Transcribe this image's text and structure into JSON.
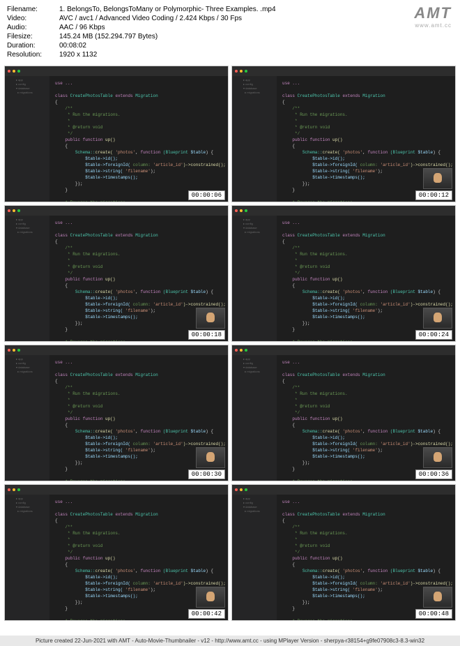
{
  "header": {
    "filename_label": "Filename:",
    "filename": "1. BelongsTo, BelongsToMany or Polymorphic-  Three Examples. .mp4",
    "video_label": "Video:",
    "video": "AVC / avc1 / Advanced Video Coding / 2.424 Kbps / 30 Fps",
    "audio_label": "Audio:",
    "audio": "AAC / 96 Kbps",
    "filesize_label": "Filesize:",
    "filesize": "145.24 MB (152.294.797 Bytes)",
    "duration_label": "Duration:",
    "duration": "00:08:02",
    "resolution_label": "Resolution:",
    "resolution": "1920 x 1132"
  },
  "logo": {
    "main": "AMT",
    "sub": "www.amt.cc"
  },
  "thumbnails": [
    {
      "timestamp": "00:00:06",
      "has_webcam": false
    },
    {
      "timestamp": "00:00:12",
      "has_webcam": true
    },
    {
      "timestamp": "00:00:18",
      "has_webcam": true
    },
    {
      "timestamp": "00:00:24",
      "has_webcam": true
    },
    {
      "timestamp": "00:00:30",
      "has_webcam": true
    },
    {
      "timestamp": "00:00:36",
      "has_webcam": true
    },
    {
      "timestamp": "00:00:42",
      "has_webcam": true
    },
    {
      "timestamp": "00:00:48",
      "has_webcam": true
    }
  ],
  "code": {
    "use": "use ...",
    "class_kw": "class",
    "class_name": "CreatePhotosTable",
    "extends_kw": "extends",
    "migration": "Migration",
    "comment1": "/**",
    "comment2": " * Run the migrations.",
    "comment3": " *",
    "comment4": " * @return void",
    "comment5": " */",
    "public_kw": "public function",
    "fn_name": "up()",
    "schema": "Schema::",
    "create": "create(",
    "table_str": "'photos'",
    "func_kw": "function",
    "blueprint": "(Blueprint",
    "table_var": "$table",
    "close_paren": ") {",
    "id_call": "$table->id();",
    "fk_call": "$table->foreignId(",
    "col_arg": "column:",
    "article_str": "'article_id'",
    "constrained": ")->constrained();",
    "string_call": "$table->string(",
    "filename_str": "'filename'",
    "semicolon": ");",
    "timestamps": "$table->timestamps();",
    "close_brace": "});",
    "close2": "}",
    "comment_rev": "* Reverse the migrations."
  },
  "footer": "Picture created 22-Jun-2021 with AMT - Auto-Movie-Thumbnailer - v12 - http://www.amt.cc - using MPlayer Version - sherpya-r38154+g9fe07908c3-8.3-win32"
}
